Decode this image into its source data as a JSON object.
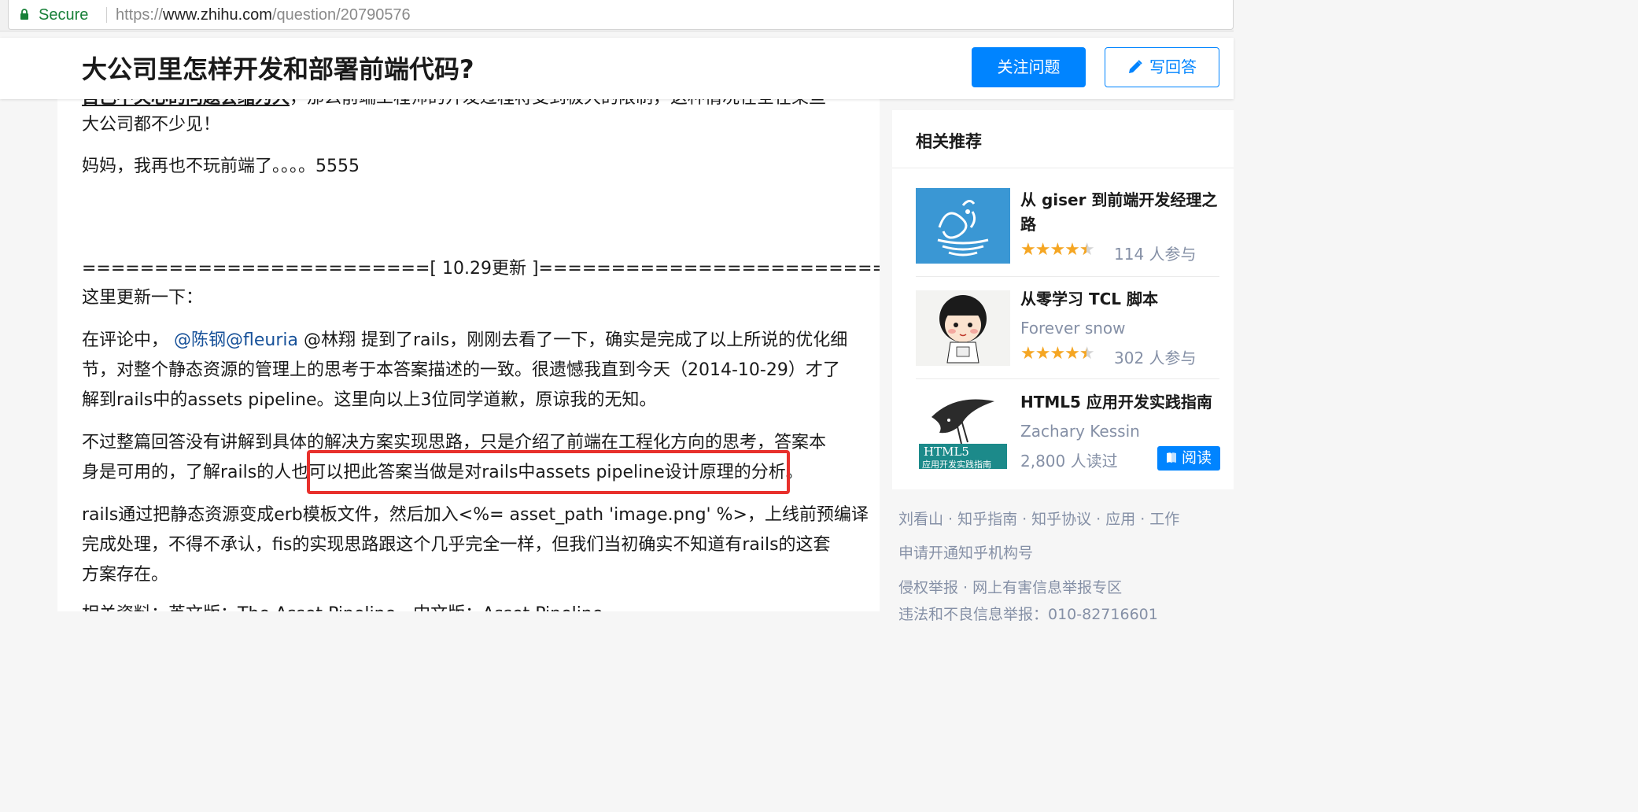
{
  "browser": {
    "secure_label": "Secure",
    "url_scheme": "https://",
    "url_host": "www.zhihu.com",
    "url_path": "/question/20790576"
  },
  "header": {
    "title": "大公司里怎样开发和部署前端代码?",
    "follow_label": "关注问题",
    "answer_label": "写回答"
  },
  "content": {
    "cut_line_1a": "自己不关心的问题会缩为大",
    "cut_line_1b": "，那么前端工程师的开发过程将受到极大的限制，这种情况在全在某些",
    "line_2": "大公司都不少见！",
    "line_3": "妈妈，我再也不玩前端了。。。。5555",
    "update_divider": "========================[ 10.29更新 ]========================",
    "update_intro": "这里更新一下：",
    "p1_l1_pre": "在评论中，",
    "p1_l1_mentions": "@陈钢@fleuria",
    "p1_l1_post": " @林翔 提到了rails，刚刚去看了一下，确实是完成了以上所说的优化细",
    "p1_l2": "节，对整个静态资源的管理上的思考于本答案描述的一致。很遗憾我直到今天（2014-10-29）才了",
    "p1_l3": "解到rails中的assets pipeline。这里向以上3位同学道歉，原谅我的无知。",
    "p2_l1": "不过整篇回答没有讲解到具体的解决方案实现思路，只是介绍了前端在工程化方向的思考，答案本",
    "p2_l2": "身是可用的，了解rails的人也可以把此答案当做是对rails中assets pipeline设计原理的分析。",
    "p3_l1": "rails通过把静态资源变成erb模板文件，然后加入<%= asset_path 'image.png' %>，上线前预编译",
    "p3_l2": "完成处理，不得不承认，fis的实现思路跟这个几乎完全一样，但我们当初确实不知道有rails的这套",
    "p3_l3": "方案存在。",
    "p4_cut": "相关资料：英文版：The Asset Pipeline，中文版：Asset Pipeline"
  },
  "sidebar": {
    "title": "相关推荐",
    "items": [
      {
        "title": "从 giser 到前端开发经理之路",
        "rating": 4.5,
        "meta": "114 人参与"
      },
      {
        "title": "从零学习 TCL 脚本",
        "author": "Forever snow",
        "rating": 4.5,
        "meta": "302 人参与"
      },
      {
        "title": "HTML5 应用开发实践指南",
        "author": "Zachary Kessin",
        "meta": "2,800 人读过",
        "action": "阅读"
      }
    ],
    "thumb_texts": {
      "html5_cover_line1": "HTML5",
      "html5_cover_line2": "应用开发实践指南"
    }
  },
  "footer": {
    "links_row1": [
      "刘看山",
      "知乎指南",
      "知乎协议",
      "应用",
      "工作"
    ],
    "link_org": "申请开通知乎机构号",
    "links_row3": [
      "侵权举报",
      "网上有害信息举报专区"
    ],
    "cut_line": "违法和不良信息举报：010-82716601"
  },
  "colors": {
    "accent": "#0084ff",
    "mention": "#175199",
    "highlight_box": "#e8302c",
    "secure_green": "#188038",
    "star": "#f5a623"
  }
}
